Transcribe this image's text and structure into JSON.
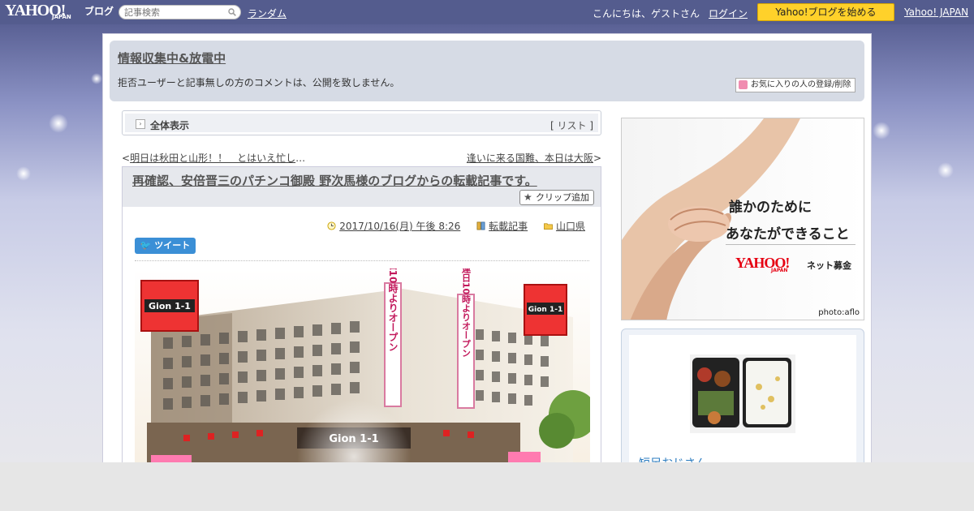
{
  "topbar": {
    "logo_text": "YAHOO!",
    "logo_japan": "JAPAN",
    "logo_blog": "ブログ",
    "search_placeholder": "記事検索",
    "random_label": "ランダム",
    "greeting": "こんにちは、ゲストさん",
    "login_label": "ログイン",
    "start_blog_label": "Yahoo!ブログを始める",
    "yahoo_japan_label": "Yahoo! JAPAN"
  },
  "header": {
    "blog_title": "情報収集中&放電中",
    "description": "拒否ユーザーと記事無しの方のコメントは、公開を致しません。",
    "favorite_button": "お気に入りの人の登録/削除"
  },
  "view_bar": {
    "label": "全体表示",
    "list_link": "リスト"
  },
  "navigation": {
    "prev_title": "明日は秋田と山形！！　とはいえ忙し",
    "prev_ellipsis": "…",
    "next_title": "逢いに来る国難、本日は大阪"
  },
  "article": {
    "title": "再確認、安倍晋三のパチンコ御殿 野次馬様のブログからの転載記事です。",
    "clip_button": "クリップ追加",
    "date": "2017/10/16(月) 午後 8:26",
    "category": "転載記事",
    "folder": "山口県",
    "tweet_button": "ツイート",
    "photo_sign_text": "Gion 1-1",
    "photo_banner_text": "連日10時よりオープン"
  },
  "sidebar": {
    "ad": {
      "line1": "誰かのために",
      "line2": "あなたができること",
      "brand": "YAHOO!",
      "brand_jp": "JAPAN",
      "service": "ネット募金",
      "credit": "photo:aflo"
    },
    "profile_name": "短足おじさん"
  },
  "colors": {
    "topbar": "#545c8e",
    "accent_button": "#ffd12a",
    "tweet": "#3b8fd6",
    "link_blue": "#2a7bbf"
  }
}
